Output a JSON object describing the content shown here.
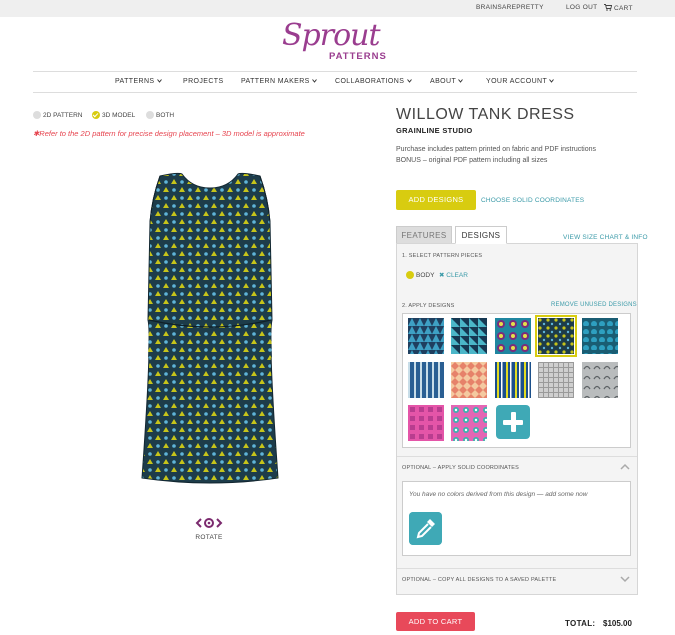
{
  "topbar": {
    "user": "BRAINSAREPRETTY",
    "logout": "LOG OUT",
    "cart": "CART"
  },
  "logo": {
    "script": "Sprout",
    "sub": "PATTERNS"
  },
  "nav": {
    "items": [
      "PATTERNS",
      "PROJECTS",
      "PATTERN MAKERS",
      "COLLABORATIONS",
      "ABOUT",
      "YOUR ACCOUNT"
    ]
  },
  "view": {
    "options": [
      "2D PATTERN",
      "3D MODEL",
      "BOTH"
    ],
    "selected": "3D MODEL",
    "warning": "✱Refer to the 2D pattern for precise design placement – 3D model is approximate",
    "rotate_label": "ROTATE"
  },
  "product": {
    "title": "WILLOW TANK DRESS",
    "brand": "GRAINLINE STUDIO",
    "desc1": "Purchase includes pattern printed on fabric and PDF instructions",
    "desc2": "BONUS – original PDF pattern including all sizes"
  },
  "actions": {
    "add_designs": "ADD DESIGNS",
    "choose_solid": "CHOOSE SOLID COORDINATES",
    "size_chart": "VIEW SIZE CHART & INFO"
  },
  "tabs": {
    "features": "FEATURES",
    "designs": "DESIGNS"
  },
  "panel": {
    "select_pieces": "1. SELECT PATTERN PIECES",
    "piece": "BODY",
    "clear": "✖ CLEAR",
    "apply_designs": "2. APPLY DESIGNS",
    "remove_unused": "REMOVE UNUSED DESIGNS",
    "optional_solid": "OPTIONAL – APPLY SOLID COORDINATES",
    "no_colors": "You have no colors derived from this design — add some now",
    "optional_copy": "OPTIONAL – COPY ALL DESIGNS TO A SAVED PALETTE"
  },
  "swatches": [
    {
      "name": "navy-tri-pattern"
    },
    {
      "name": "blue-teal-triangles"
    },
    {
      "name": "magenta-teal-kaleido"
    },
    {
      "name": "navy-chartreuse-dots",
      "selected": true
    },
    {
      "name": "teal-scallops"
    },
    {
      "name": "blue-vertical-stripes"
    },
    {
      "name": "peach-diamond"
    },
    {
      "name": "yellow-blue-stripes"
    },
    {
      "name": "grey-grid"
    },
    {
      "name": "grey-bird-print"
    },
    {
      "name": "pink-geometric"
    },
    {
      "name": "pink-teal-lattice"
    }
  ],
  "cart": {
    "button": "ADD TO CART",
    "total_label": "TOTAL:",
    "total_value": "$105.00"
  },
  "colors": {
    "accent_yellow": "#d8cc10",
    "teal": "#3fa9b6",
    "pink": "#e8495a",
    "purple": "#9a3d8f"
  }
}
